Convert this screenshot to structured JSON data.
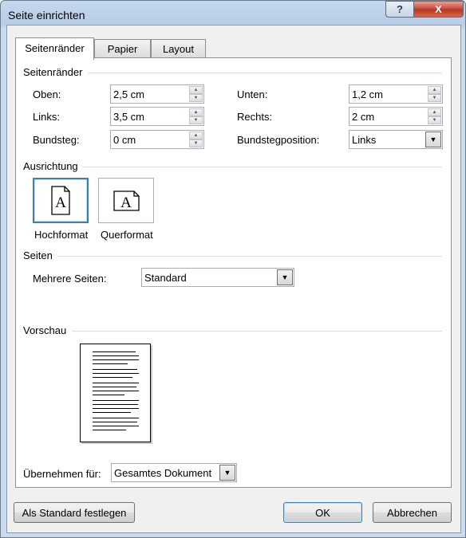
{
  "window": {
    "title": "Seite einrichten"
  },
  "tabs": [
    {
      "label": "Seitenränder",
      "active": true
    },
    {
      "label": "Papier",
      "active": false
    },
    {
      "label": "Layout",
      "active": false
    }
  ],
  "margins": {
    "section_title": "Seitenränder",
    "top_label": "Oben:",
    "top_value": "2,5 cm",
    "left_label": "Links:",
    "left_value": "3,5 cm",
    "gutter_label": "Bundsteg:",
    "gutter_value": "0 cm",
    "bottom_label": "Unten:",
    "bottom_value": "1,2 cm",
    "right_label": "Rechts:",
    "right_value": "2 cm",
    "gutter_position_label": "Bundstegposition:",
    "gutter_position_value": "Links"
  },
  "orientation": {
    "section_title": "Ausrichtung",
    "portrait_label": "Hochformat",
    "landscape_label": "Querformat",
    "icon_letter": "A",
    "selected": "Hochformat"
  },
  "pages": {
    "section_title": "Seiten",
    "multiple_pages_label": "Mehrere Seiten:",
    "multiple_pages_value": "Standard"
  },
  "preview": {
    "section_title": "Vorschau"
  },
  "apply_to": {
    "label": "Übernehmen für:",
    "value": "Gesamtes Dokument"
  },
  "buttons": {
    "default": "Als Standard festlegen",
    "ok": "OK",
    "cancel": "Abbrechen",
    "help_icon": "?",
    "close_icon": "X"
  },
  "colors": {
    "titlebar": "#b8cde6",
    "focus_border": "#3c7fb1",
    "close_red": "#c7473b"
  }
}
